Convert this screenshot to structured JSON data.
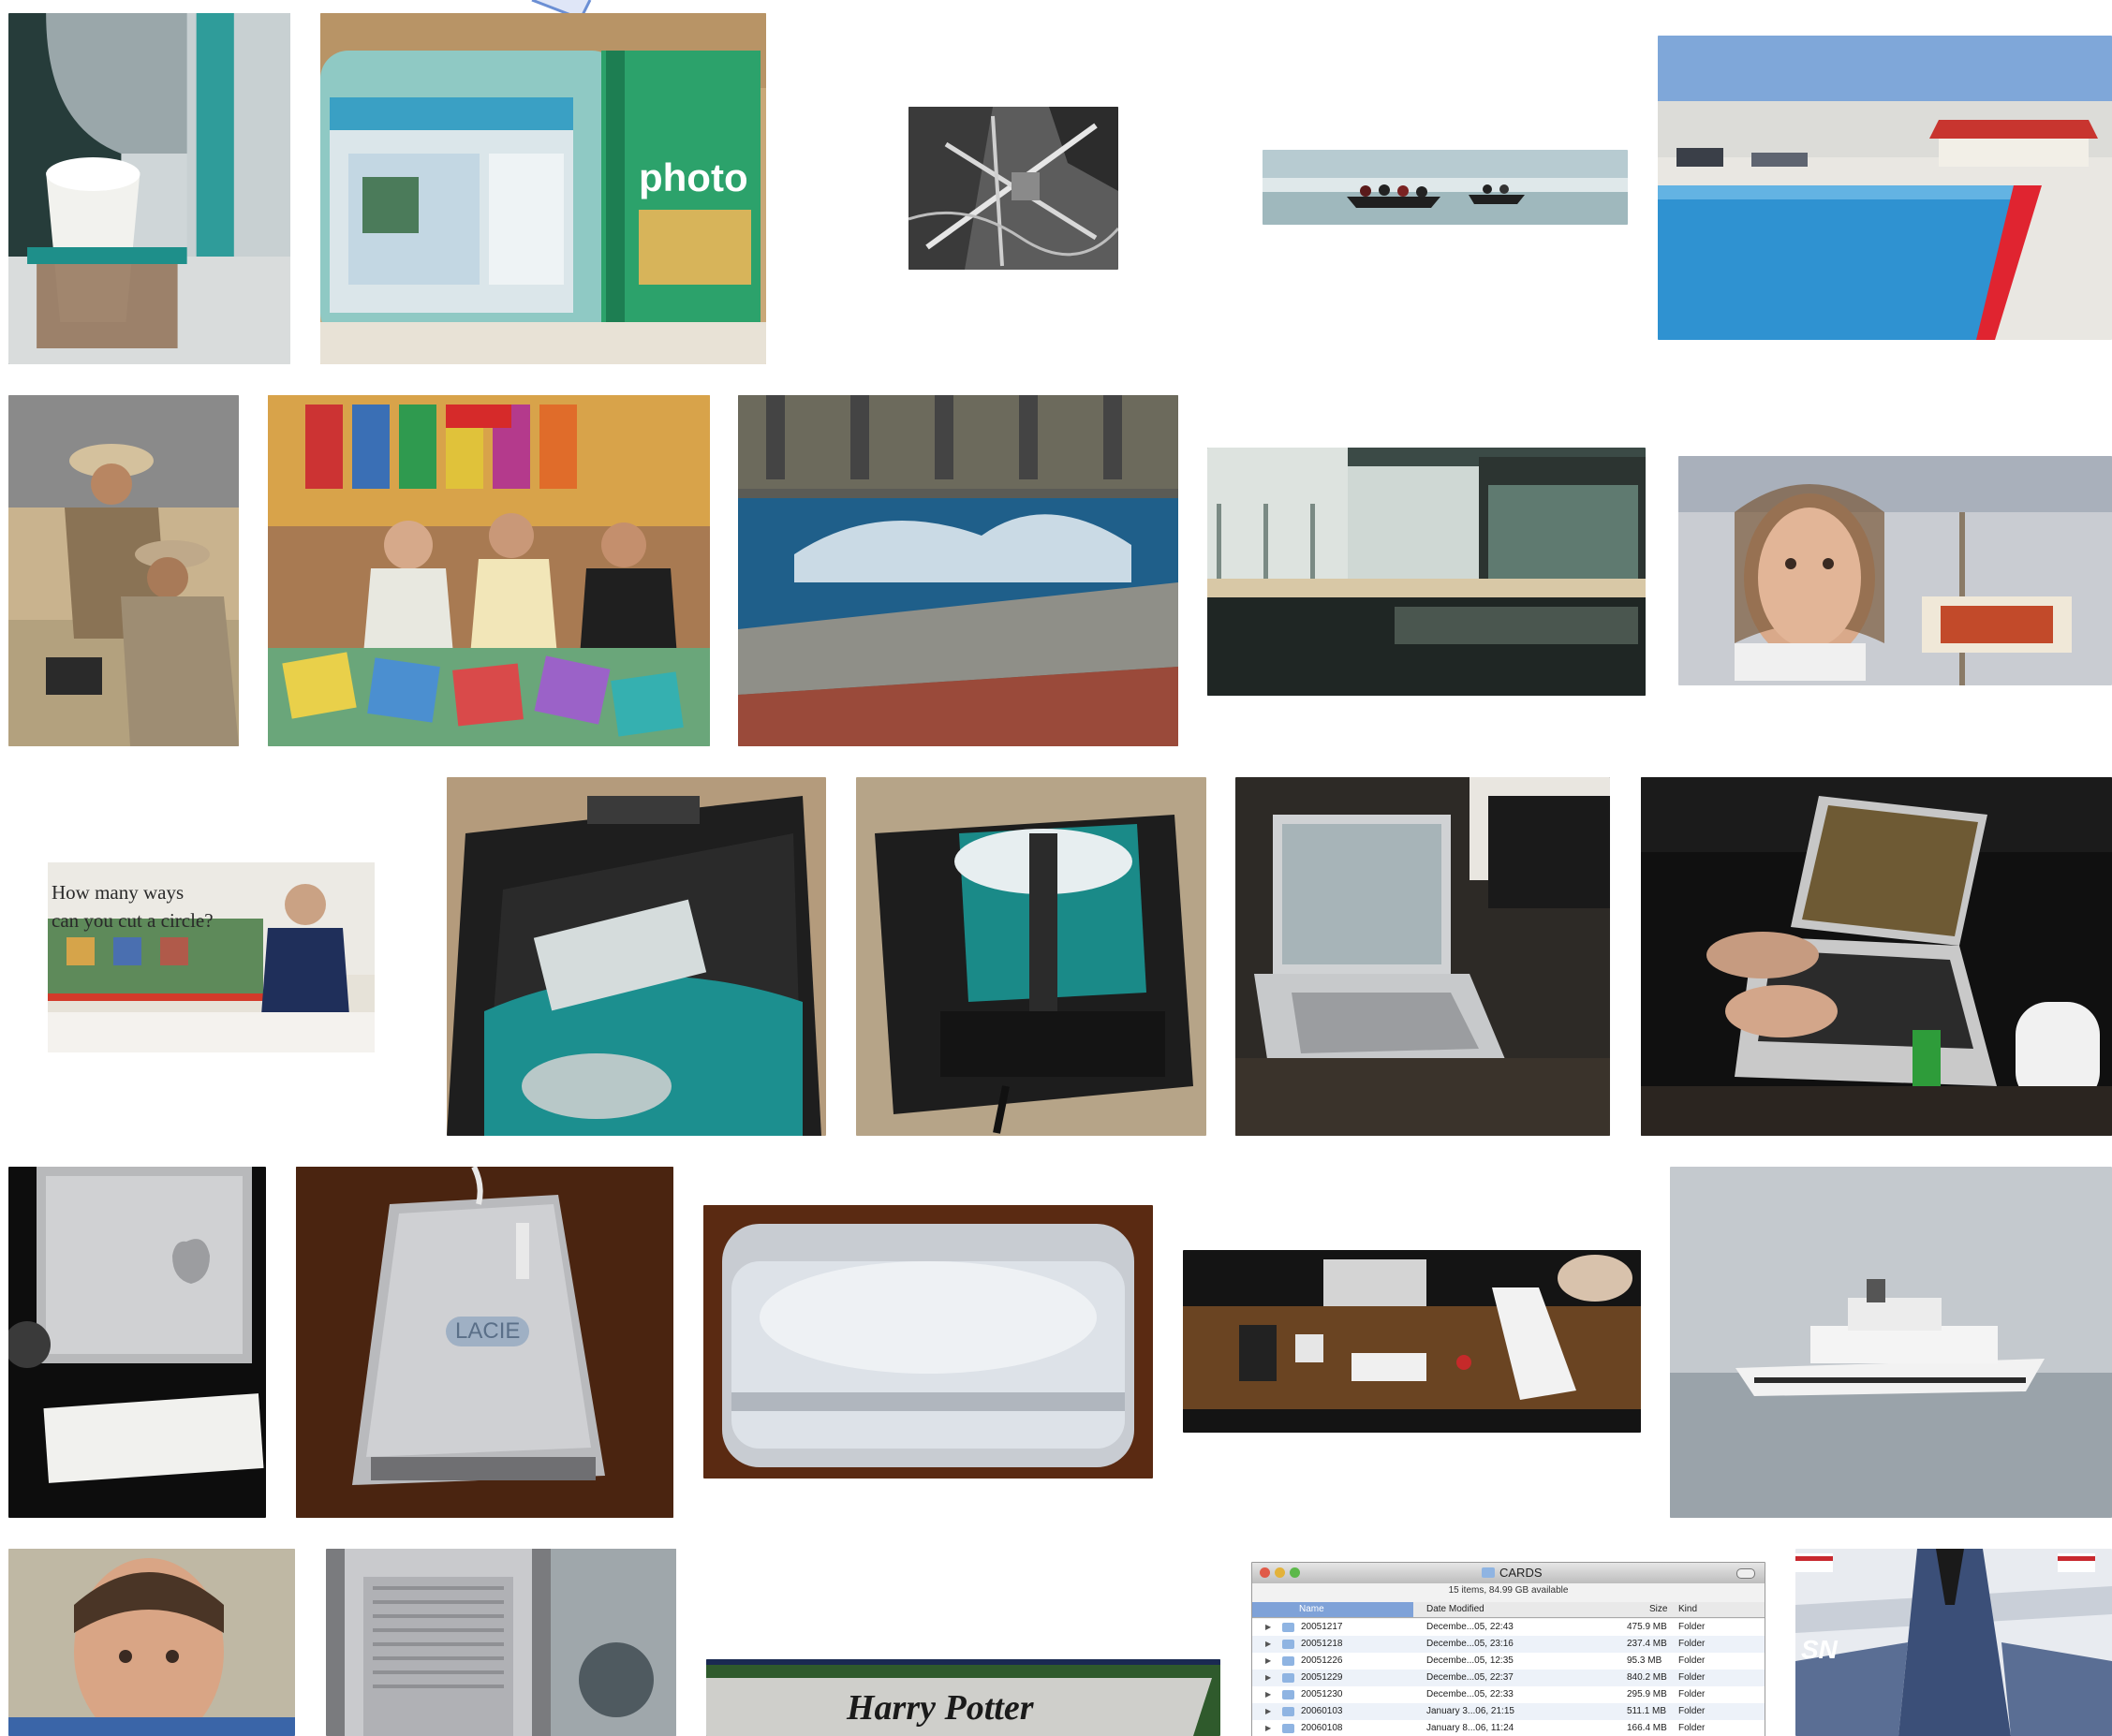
{
  "page": {
    "title": ""
  },
  "tiles": [
    {
      "id": "t1",
      "subject": "teal computer with paper cup"
    },
    {
      "id": "t2",
      "subject": "iMac with photo software box"
    },
    {
      "id": "t3",
      "subject": "aerial view of airfield"
    },
    {
      "id": "t4",
      "subject": "boats by glacier"
    },
    {
      "id": "t5",
      "subject": "pool with red building"
    },
    {
      "id": "t6",
      "subject": "soldiers working"
    },
    {
      "id": "t7",
      "subject": "people browsing books"
    },
    {
      "id": "t8",
      "subject": "fountain"
    },
    {
      "id": "t9",
      "subject": "mall interior"
    },
    {
      "id": "t10",
      "subject": "billboard of woman"
    },
    {
      "id": "t11",
      "subject": "teacher by bulletin board",
      "text": {
        "line1": "How many ways",
        "line2": "can you cut a circle?"
      }
    },
    {
      "id": "t12",
      "subject": "teal computer in bag"
    },
    {
      "id": "t13",
      "subject": "computer in black carry bag"
    },
    {
      "id": "t14",
      "subject": "laptop on desk"
    },
    {
      "id": "t15",
      "subject": "person typing on laptop"
    },
    {
      "id": "t16",
      "subject": "silver cube computer"
    },
    {
      "id": "t17",
      "subject": "external drive",
      "text": {
        "brand": "LACIE"
      }
    },
    {
      "id": "t18",
      "subject": "white mouse in box"
    },
    {
      "id": "t19",
      "subject": "laptops on messy desk"
    },
    {
      "id": "t20",
      "subject": "ship at sea"
    },
    {
      "id": "t21",
      "subject": "portrait of man"
    },
    {
      "id": "t22",
      "subject": "tower computer"
    },
    {
      "id": "t23",
      "subject": "book cover",
      "text": {
        "title": "Harry Potter"
      }
    },
    {
      "id": "t24",
      "subject": "finder window screenshot",
      "text": {
        "window_title": "CARDS",
        "status": "15 items, 84.99 GB available",
        "headers": [
          "Name",
          "Date Modified",
          "Size",
          "Kind"
        ],
        "rows": [
          [
            "20051217",
            "Decembe...05, 22:43",
            "475.9 MB",
            "Folder"
          ],
          [
            "20051218",
            "Decembe...05, 23:16",
            "237.4 MB",
            "Folder"
          ],
          [
            "20051226",
            "Decembe...05, 12:35",
            "95.3 MB",
            "Folder"
          ],
          [
            "20051229",
            "Decembe...05, 22:37",
            "840.2 MB",
            "Folder"
          ],
          [
            "20051230",
            "Decembe...05, 22:33",
            "295.9 MB",
            "Folder"
          ],
          [
            "20060103",
            "January 3...06, 21:15",
            "511.1 MB",
            "Folder"
          ],
          [
            "20060108",
            "January 8...06, 11:24",
            "166.4 MB",
            "Folder"
          ]
        ]
      }
    },
    {
      "id": "t25",
      "subject": "jet aircraft",
      "text": {
        "marking": "SN"
      }
    }
  ],
  "colors": {
    "background": "#ffffff",
    "accent_blue": "#6b8fd4"
  }
}
